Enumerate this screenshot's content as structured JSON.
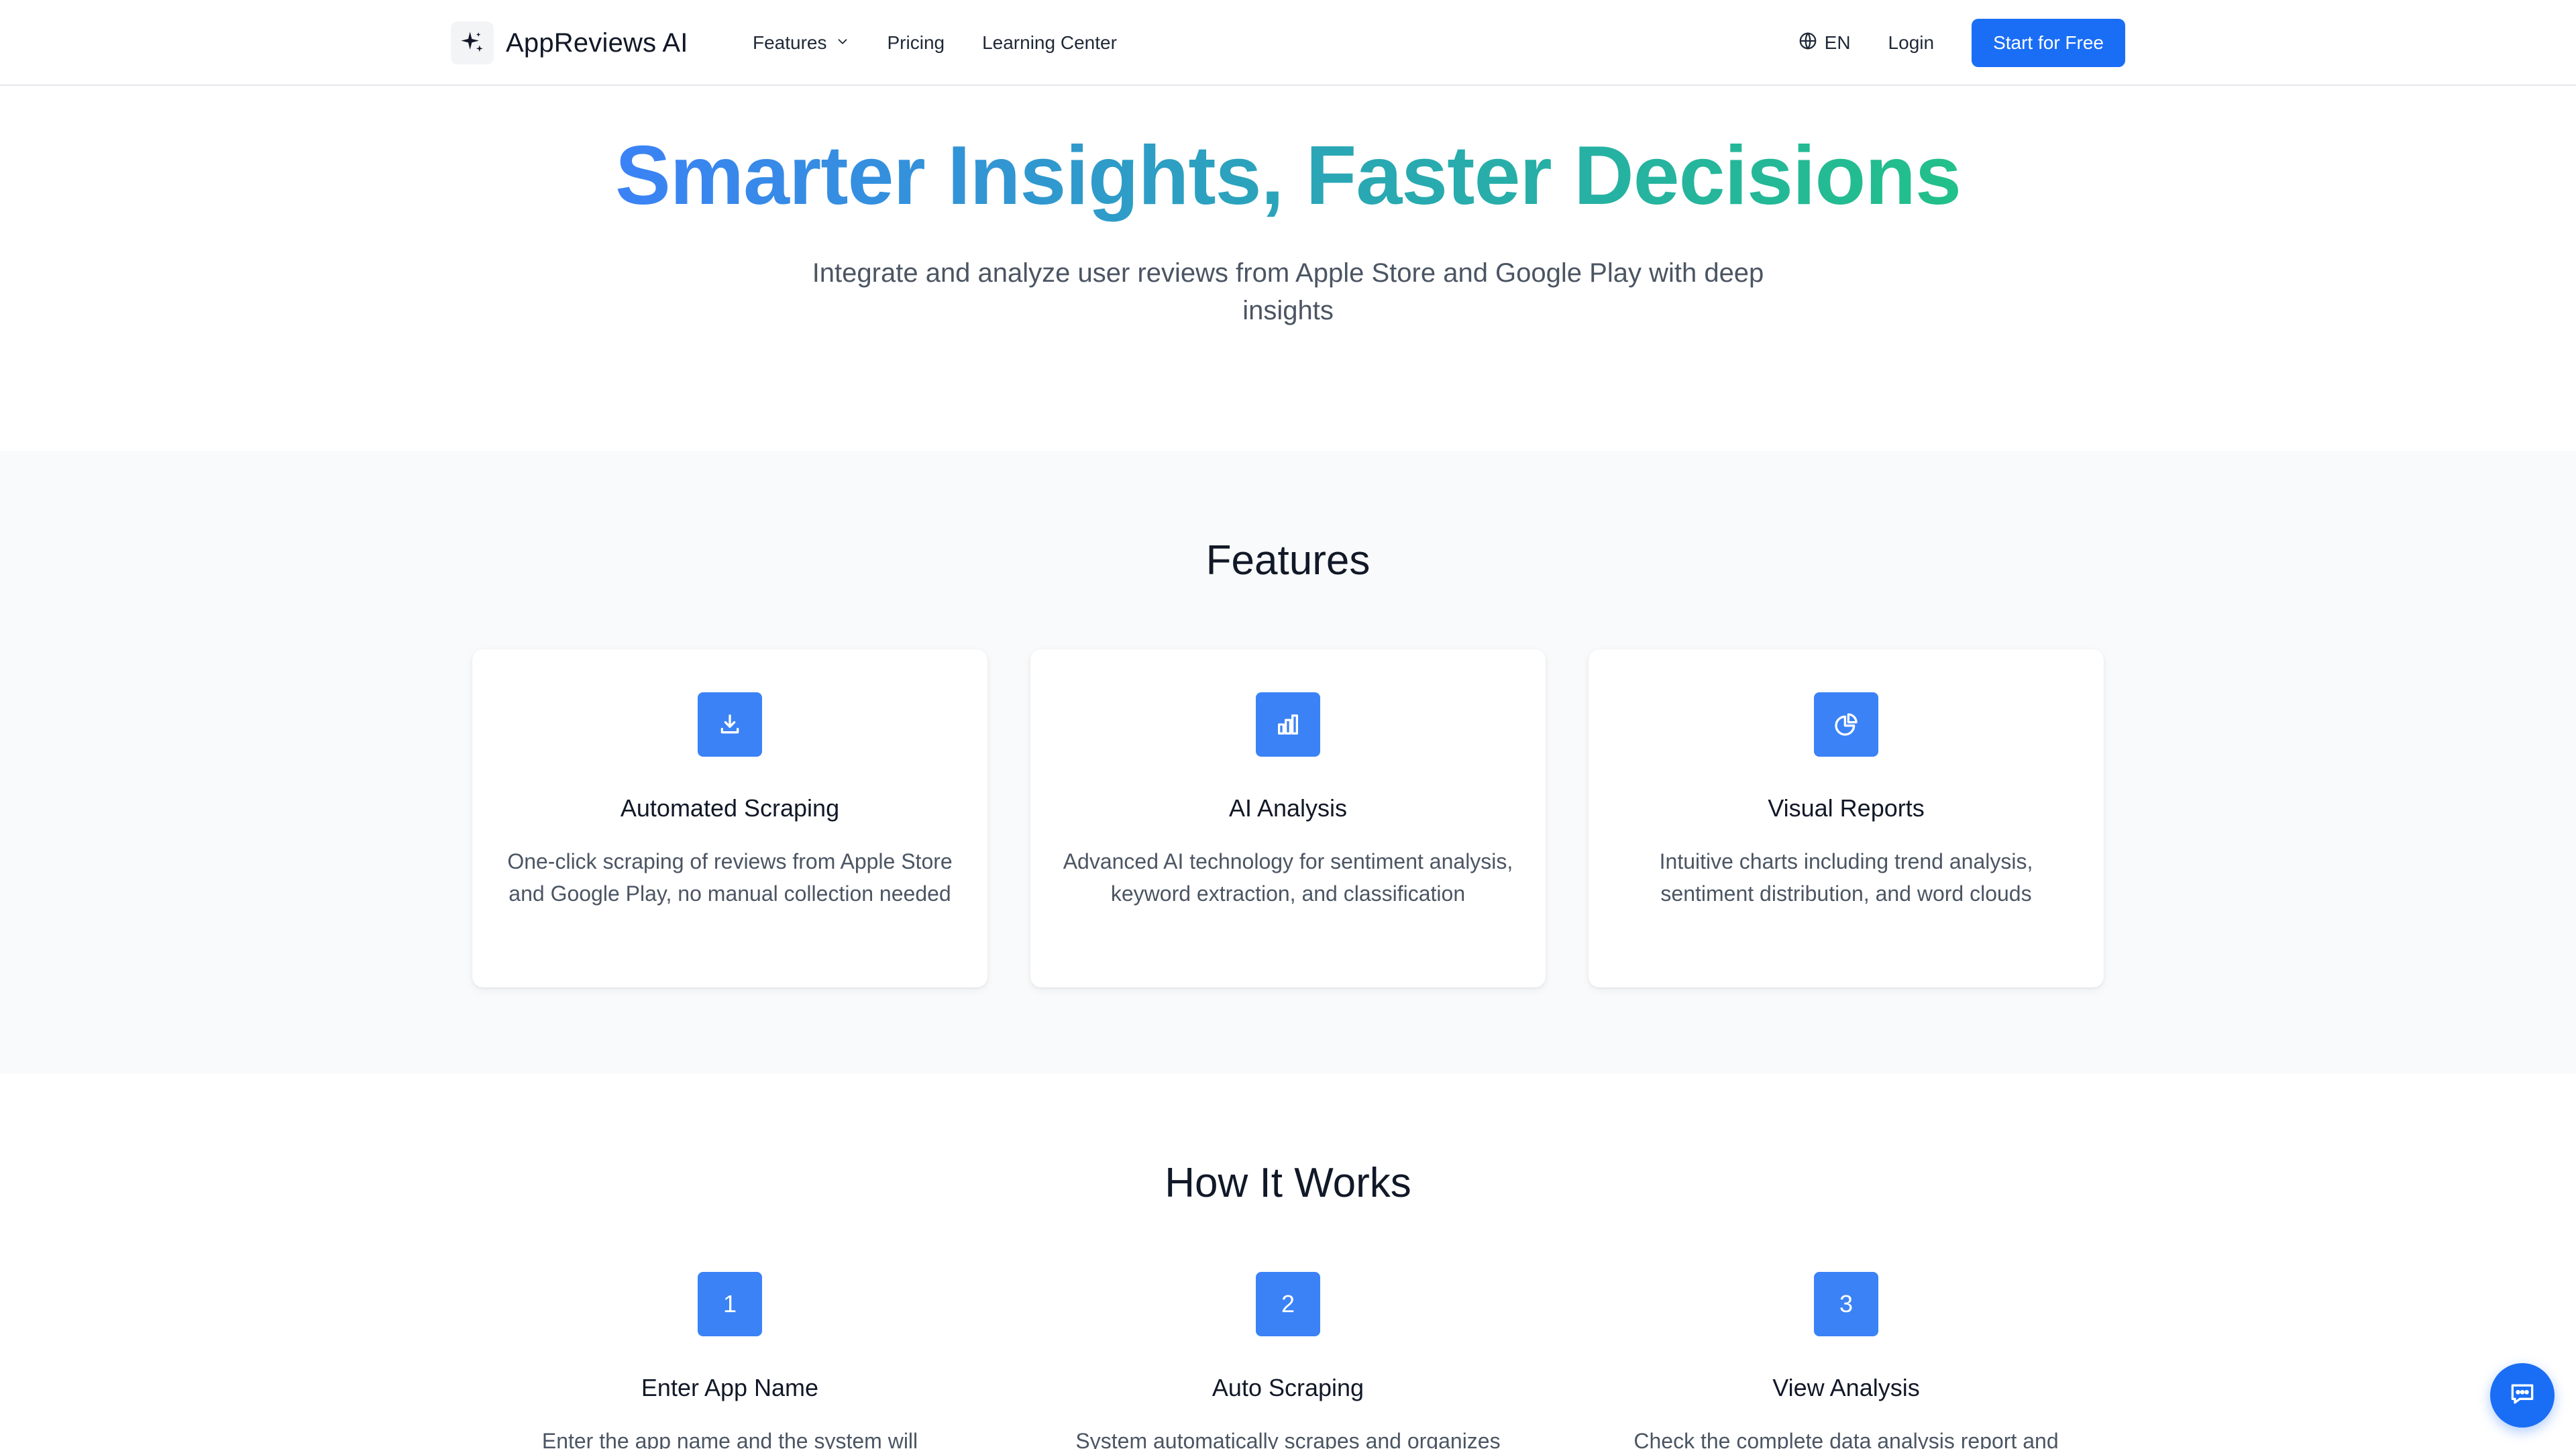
{
  "header": {
    "logo_text": "AppReviews AI",
    "nav": [
      {
        "label": "Features",
        "has_dropdown": true
      },
      {
        "label": "Pricing"
      },
      {
        "label": "Learning Center"
      }
    ],
    "language": "EN",
    "login_label": "Login",
    "cta_label": "Start for Free"
  },
  "hero": {
    "title": "Smarter Insights, Faster Decisions",
    "subtitle": "Integrate and analyze user reviews from Apple Store and Google Play with deep insights"
  },
  "features": {
    "title": "Features",
    "cards": [
      {
        "icon": "download-icon",
        "title": "Automated Scraping",
        "description": "One-click scraping of reviews from Apple Store and Google Play, no manual collection needed"
      },
      {
        "icon": "bar-chart-icon",
        "title": "AI Analysis",
        "description": "Advanced AI technology for sentiment analysis, keyword extraction, and classification"
      },
      {
        "icon": "pie-chart-icon",
        "title": "Visual Reports",
        "description": "Intuitive charts including trend analysis, sentiment distribution, and word clouds"
      }
    ]
  },
  "how_it_works": {
    "title": "How It Works",
    "steps": [
      {
        "number": "1",
        "title": "Enter App Name",
        "description": "Enter the app name and the system will"
      },
      {
        "number": "2",
        "title": "Auto Scraping",
        "description": "System automatically scrapes and organizes review"
      },
      {
        "number": "3",
        "title": "View Analysis",
        "description": "Check the complete data analysis report and"
      }
    ]
  },
  "colors": {
    "primary": "#1a6ef5",
    "icon_bg": "#3b82f6",
    "gradient_start": "#3b82f6",
    "gradient_end": "#22c08a",
    "section_bg": "#f9fafb"
  },
  "chat_widget": {
    "icon": "chat-icon"
  }
}
